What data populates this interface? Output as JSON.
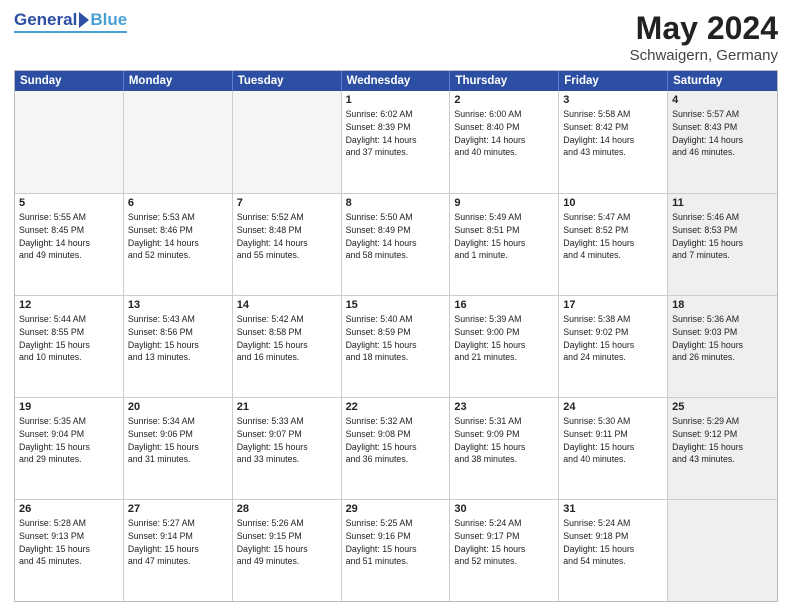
{
  "logo": {
    "general": "General",
    "blue": "Blue"
  },
  "title": {
    "month": "May 2024",
    "location": "Schwaigern, Germany"
  },
  "header": {
    "days": [
      "Sunday",
      "Monday",
      "Tuesday",
      "Wednesday",
      "Thursday",
      "Friday",
      "Saturday"
    ]
  },
  "rows": [
    {
      "cells": [
        {
          "day": "",
          "info": "",
          "empty": true
        },
        {
          "day": "",
          "info": "",
          "empty": true
        },
        {
          "day": "",
          "info": "",
          "empty": true
        },
        {
          "day": "1",
          "info": "Sunrise: 6:02 AM\nSunset: 8:39 PM\nDaylight: 14 hours\nand 37 minutes."
        },
        {
          "day": "2",
          "info": "Sunrise: 6:00 AM\nSunset: 8:40 PM\nDaylight: 14 hours\nand 40 minutes."
        },
        {
          "day": "3",
          "info": "Sunrise: 5:58 AM\nSunset: 8:42 PM\nDaylight: 14 hours\nand 43 minutes."
        },
        {
          "day": "4",
          "info": "Sunrise: 5:57 AM\nSunset: 8:43 PM\nDaylight: 14 hours\nand 46 minutes.",
          "shaded": true
        }
      ]
    },
    {
      "cells": [
        {
          "day": "5",
          "info": "Sunrise: 5:55 AM\nSunset: 8:45 PM\nDaylight: 14 hours\nand 49 minutes."
        },
        {
          "day": "6",
          "info": "Sunrise: 5:53 AM\nSunset: 8:46 PM\nDaylight: 14 hours\nand 52 minutes."
        },
        {
          "day": "7",
          "info": "Sunrise: 5:52 AM\nSunset: 8:48 PM\nDaylight: 14 hours\nand 55 minutes."
        },
        {
          "day": "8",
          "info": "Sunrise: 5:50 AM\nSunset: 8:49 PM\nDaylight: 14 hours\nand 58 minutes."
        },
        {
          "day": "9",
          "info": "Sunrise: 5:49 AM\nSunset: 8:51 PM\nDaylight: 15 hours\nand 1 minute."
        },
        {
          "day": "10",
          "info": "Sunrise: 5:47 AM\nSunset: 8:52 PM\nDaylight: 15 hours\nand 4 minutes."
        },
        {
          "day": "11",
          "info": "Sunrise: 5:46 AM\nSunset: 8:53 PM\nDaylight: 15 hours\nand 7 minutes.",
          "shaded": true
        }
      ]
    },
    {
      "cells": [
        {
          "day": "12",
          "info": "Sunrise: 5:44 AM\nSunset: 8:55 PM\nDaylight: 15 hours\nand 10 minutes."
        },
        {
          "day": "13",
          "info": "Sunrise: 5:43 AM\nSunset: 8:56 PM\nDaylight: 15 hours\nand 13 minutes."
        },
        {
          "day": "14",
          "info": "Sunrise: 5:42 AM\nSunset: 8:58 PM\nDaylight: 15 hours\nand 16 minutes."
        },
        {
          "day": "15",
          "info": "Sunrise: 5:40 AM\nSunset: 8:59 PM\nDaylight: 15 hours\nand 18 minutes."
        },
        {
          "day": "16",
          "info": "Sunrise: 5:39 AM\nSunset: 9:00 PM\nDaylight: 15 hours\nand 21 minutes."
        },
        {
          "day": "17",
          "info": "Sunrise: 5:38 AM\nSunset: 9:02 PM\nDaylight: 15 hours\nand 24 minutes."
        },
        {
          "day": "18",
          "info": "Sunrise: 5:36 AM\nSunset: 9:03 PM\nDaylight: 15 hours\nand 26 minutes.",
          "shaded": true
        }
      ]
    },
    {
      "cells": [
        {
          "day": "19",
          "info": "Sunrise: 5:35 AM\nSunset: 9:04 PM\nDaylight: 15 hours\nand 29 minutes."
        },
        {
          "day": "20",
          "info": "Sunrise: 5:34 AM\nSunset: 9:06 PM\nDaylight: 15 hours\nand 31 minutes."
        },
        {
          "day": "21",
          "info": "Sunrise: 5:33 AM\nSunset: 9:07 PM\nDaylight: 15 hours\nand 33 minutes."
        },
        {
          "day": "22",
          "info": "Sunrise: 5:32 AM\nSunset: 9:08 PM\nDaylight: 15 hours\nand 36 minutes."
        },
        {
          "day": "23",
          "info": "Sunrise: 5:31 AM\nSunset: 9:09 PM\nDaylight: 15 hours\nand 38 minutes."
        },
        {
          "day": "24",
          "info": "Sunrise: 5:30 AM\nSunset: 9:11 PM\nDaylight: 15 hours\nand 40 minutes."
        },
        {
          "day": "25",
          "info": "Sunrise: 5:29 AM\nSunset: 9:12 PM\nDaylight: 15 hours\nand 43 minutes.",
          "shaded": true
        }
      ]
    },
    {
      "cells": [
        {
          "day": "26",
          "info": "Sunrise: 5:28 AM\nSunset: 9:13 PM\nDaylight: 15 hours\nand 45 minutes."
        },
        {
          "day": "27",
          "info": "Sunrise: 5:27 AM\nSunset: 9:14 PM\nDaylight: 15 hours\nand 47 minutes."
        },
        {
          "day": "28",
          "info": "Sunrise: 5:26 AM\nSunset: 9:15 PM\nDaylight: 15 hours\nand 49 minutes."
        },
        {
          "day": "29",
          "info": "Sunrise: 5:25 AM\nSunset: 9:16 PM\nDaylight: 15 hours\nand 51 minutes."
        },
        {
          "day": "30",
          "info": "Sunrise: 5:24 AM\nSunset: 9:17 PM\nDaylight: 15 hours\nand 52 minutes."
        },
        {
          "day": "31",
          "info": "Sunrise: 5:24 AM\nSunset: 9:18 PM\nDaylight: 15 hours\nand 54 minutes."
        },
        {
          "day": "",
          "info": "",
          "empty": true,
          "shaded": true
        }
      ]
    }
  ]
}
